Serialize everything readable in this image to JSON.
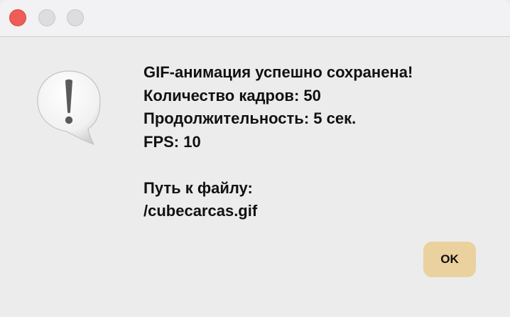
{
  "dialog": {
    "message_lines": [
      "GIF-анимация успешно сохранена!",
      "Количество кадров: 50",
      "Продолжительность: 5 сек.",
      "FPS: 10"
    ],
    "path_label": "Путь к файлу:",
    "path_value": "/cubecarcas.gif",
    "ok_label": "OK",
    "icon": "exclamation-speech-bubble-icon"
  },
  "colors": {
    "close": "#ee5d57",
    "ok_button": "#ead19d",
    "background": "#ececec"
  }
}
